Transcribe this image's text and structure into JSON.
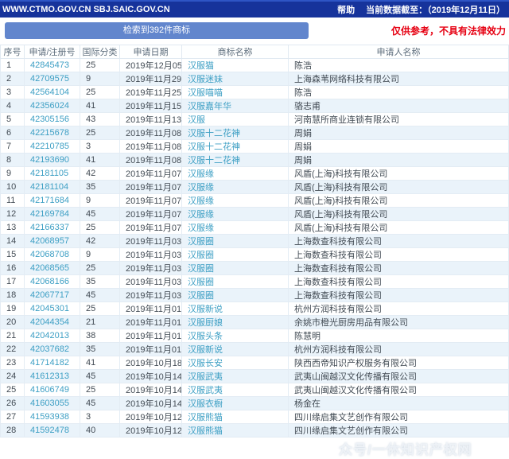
{
  "topbar": {
    "site_title": "WWW.CTMO.GOV.CN SBJ.SAIC.GOV.CN",
    "help_label": "帮助",
    "data_as_of": "当前数据截至：（2019年12月11日）"
  },
  "toolbar": {
    "result_count_label": "检索到392件商标",
    "disclaimer": "仅供参考，不具有法律效力"
  },
  "table": {
    "headers": [
      "序号",
      "申请/注册号",
      "国际分类",
      "申请日期",
      "商标名称",
      "申请人名称"
    ],
    "rows": [
      [
        "1",
        "42845473",
        "25",
        "2019年12月05日",
        "汉服猫",
        "陈浩"
      ],
      [
        "2",
        "42709575",
        "9",
        "2019年11月29日",
        "汉服迷妹",
        "上海森苇网络科技有限公司"
      ],
      [
        "3",
        "42564104",
        "25",
        "2019年11月25日",
        "汉服喵喵",
        "陈浩"
      ],
      [
        "4",
        "42356024",
        "41",
        "2019年11月15日",
        "汉服嘉年华",
        "骆志甫"
      ],
      [
        "5",
        "42305156",
        "43",
        "2019年11月13日",
        "汉服",
        "河南慧所商业连锁有限公司"
      ],
      [
        "6",
        "42215678",
        "25",
        "2019年11月08日",
        "汉服十二花神",
        "周娟"
      ],
      [
        "7",
        "42210785",
        "3",
        "2019年11月08日",
        "汉服十二花神",
        "周娟"
      ],
      [
        "8",
        "42193690",
        "41",
        "2019年11月08日",
        "汉服十二花神",
        "周娟"
      ],
      [
        "9",
        "42181105",
        "42",
        "2019年11月07日",
        "汉服缘",
        "风盾(上海)科技有限公司"
      ],
      [
        "10",
        "42181104",
        "35",
        "2019年11月07日",
        "汉服缘",
        "风盾(上海)科技有限公司"
      ],
      [
        "11",
        "42171684",
        "9",
        "2019年11月07日",
        "汉服缘",
        "风盾(上海)科技有限公司"
      ],
      [
        "12",
        "42169784",
        "45",
        "2019年11月07日",
        "汉服缘",
        "风盾(上海)科技有限公司"
      ],
      [
        "13",
        "42166337",
        "25",
        "2019年11月07日",
        "汉服缘",
        "风盾(上海)科技有限公司"
      ],
      [
        "14",
        "42068957",
        "42",
        "2019年11月03日",
        "汉服圈",
        "上海数查科技有限公司"
      ],
      [
        "15",
        "42068708",
        "9",
        "2019年11月03日",
        "汉服圈",
        "上海数查科技有限公司"
      ],
      [
        "16",
        "42068565",
        "25",
        "2019年11月03日",
        "汉服圈",
        "上海数查科技有限公司"
      ],
      [
        "17",
        "42068166",
        "35",
        "2019年11月03日",
        "汉服圈",
        "上海数查科技有限公司"
      ],
      [
        "18",
        "42067717",
        "45",
        "2019年11月03日",
        "汉服圈",
        "上海数查科技有限公司"
      ],
      [
        "19",
        "42045301",
        "25",
        "2019年11月01日",
        "汉服新说",
        "杭州方润科技有限公司"
      ],
      [
        "20",
        "42044354",
        "21",
        "2019年11月01日",
        "汉服厨娘",
        "余姚市橙光厨房用品有限公司"
      ],
      [
        "21",
        "42042013",
        "38",
        "2019年11月01日",
        "汉服头条",
        "陈慧明"
      ],
      [
        "22",
        "42037682",
        "35",
        "2019年11月01日",
        "汉服新说",
        "杭州方润科技有限公司"
      ],
      [
        "23",
        "41714182",
        "41",
        "2019年10月18日",
        "汉服长安",
        "陕西西帝知识产权服务有限公司"
      ],
      [
        "24",
        "41612313",
        "45",
        "2019年10月14日",
        "汉服武夷",
        "武夷山闽越汉文化传播有限公司"
      ],
      [
        "25",
        "41606749",
        "25",
        "2019年10月14日",
        "汉服武夷",
        "武夷山闽越汉文化传播有限公司"
      ],
      [
        "26",
        "41603055",
        "45",
        "2019年10月14日",
        "汉服衣橱",
        "杨金在"
      ],
      [
        "27",
        "41593938",
        "3",
        "2019年10月12日",
        "汉服熊猫",
        "四川缘启集文艺创作有限公司"
      ],
      [
        "28",
        "41592478",
        "40",
        "2019年10月12日",
        "汉服熊猫",
        "四川缘启集文艺创作有限公司"
      ]
    ]
  },
  "watermark": "众号/一休知识产权网",
  "colors": {
    "topbar_bg": "#16339b",
    "topbar_top_edge": "#2e55c5",
    "count_button_bg": "#6286cd",
    "link_text": "#3d9fc4",
    "disclaimer_text": "#e60012",
    "row_alt_bg": "#eaf3fa",
    "table_border": "#e3ecf4"
  }
}
